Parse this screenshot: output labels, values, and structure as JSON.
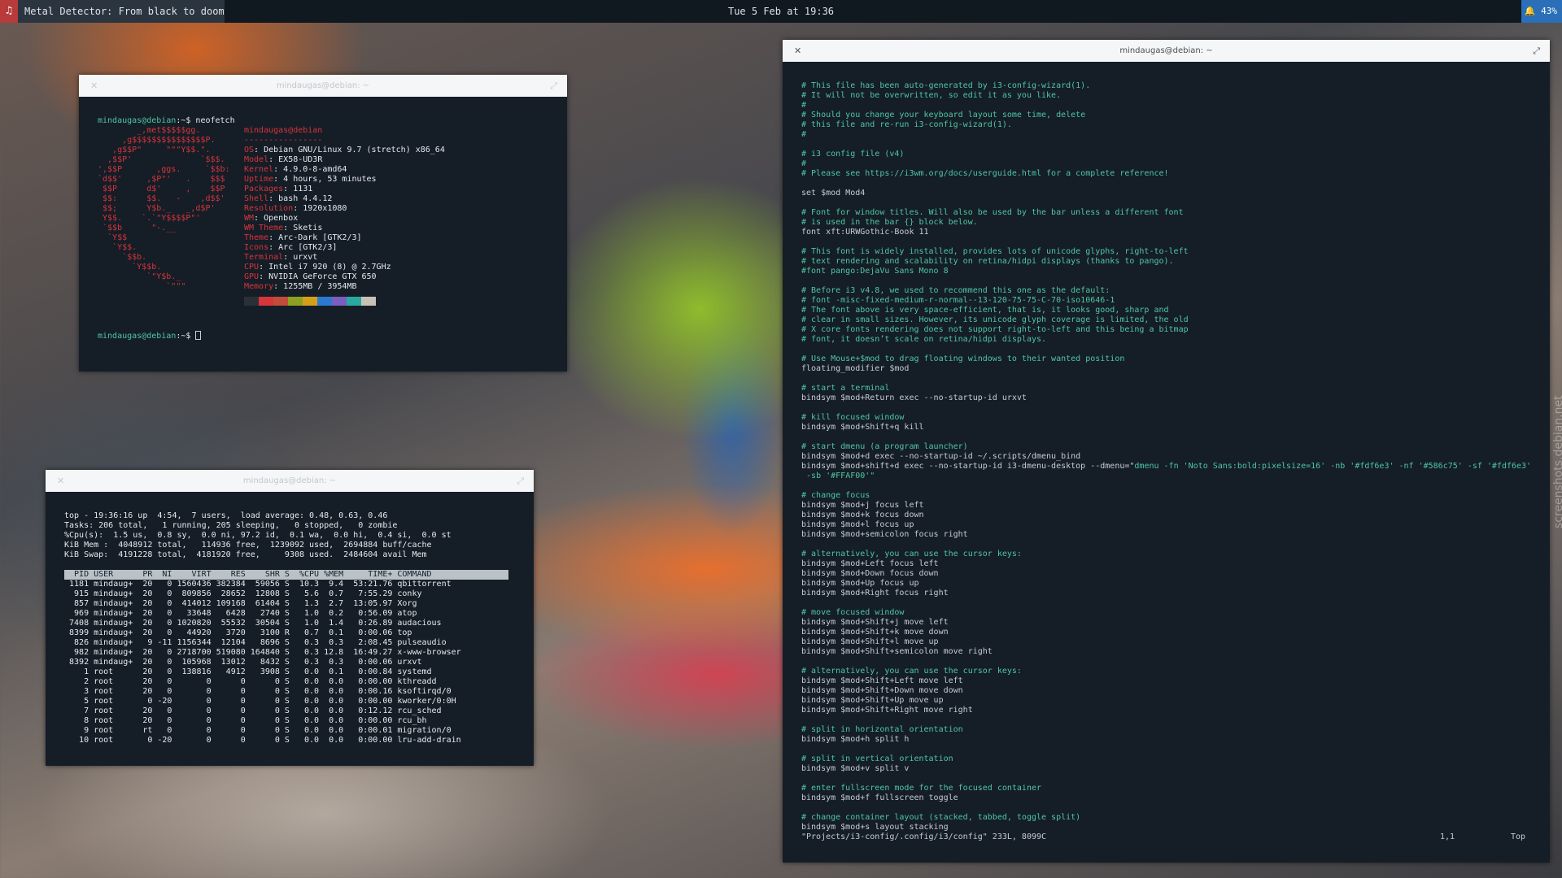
{
  "topbar": {
    "workspace": "♫",
    "window_title": "Metal Detector: From black to doom, prog",
    "clock": "Tue 5 Feb at 19:36",
    "battery": "🔔 43%"
  },
  "win_neofetch": {
    "title": "mindaugas@debian: ~",
    "close": "✕",
    "expand": "⤢",
    "prompt": "mindaugas@debian",
    "path_prompt": ":~$ ",
    "command": "neofetch",
    "user_host": "mindaugas@debian",
    "separator": "----------------",
    "logo": [
      "        _,met$$$$$gg.",
      "     ,g$$$$$$$$$$$$$$$P.",
      "   ,g$$P\"     \"\"\"Y$$.\".",
      "  ,$$P'              `$$$.",
      "',$$P       ,ggs.     `$$b:",
      "`d$$'     ,$P\"'   .    $$$",
      " $$P      d$'     ,    $$P",
      " $$:      $$.   -    ,d$$'",
      " $$;      Y$b._   _,d$P'",
      " Y$$.    `.`\"Y$$$$P\"'",
      " `$$b      \"-.__",
      "  `Y$$",
      "   `Y$$.",
      "     `$$b.",
      "       `Y$$b.",
      "          `\"Y$b._",
      "              `\"\"\""
    ],
    "info": [
      {
        "k": "OS",
        "v": "Debian GNU/Linux 9.7 (stretch) x86_64"
      },
      {
        "k": "Model",
        "v": "EX58-UD3R"
      },
      {
        "k": "Kernel",
        "v": "4.9.0-8-amd64"
      },
      {
        "k": "Uptime",
        "v": "4 hours, 53 minutes"
      },
      {
        "k": "Packages",
        "v": "1131"
      },
      {
        "k": "Shell",
        "v": "bash 4.4.12"
      },
      {
        "k": "Resolution",
        "v": "1920x1080"
      },
      {
        "k": "WM",
        "v": "Openbox"
      },
      {
        "k": "WM Theme",
        "v": "Sketis"
      },
      {
        "k": "Theme",
        "v": "Arc-Dark [GTK2/3]"
      },
      {
        "k": "Icons",
        "v": "Arc [GTK2/3]"
      },
      {
        "k": "Terminal",
        "v": "urxvt"
      },
      {
        "k": "CPU",
        "v": "Intel i7 920 (8) @ 2.7GHz"
      },
      {
        "k": "GPU",
        "v": "NVIDIA GeForce GTX 650"
      },
      {
        "k": "Memory",
        "v": "1255MB / 3954MB"
      }
    ],
    "colors": [
      "#2b2f36",
      "#d6353a",
      "#c14c3b",
      "#8ea021",
      "#d5a019",
      "#2a7bd0",
      "#7a5fc0",
      "#2aa9a0",
      "#c8c2b6"
    ]
  },
  "win_top": {
    "title": "mindaugas@debian: ~",
    "close": "✕",
    "expand": "⤢",
    "summary": [
      "top - 19:36:16 up  4:54,  7 users,  load average: 0.48, 0.63, 0.46",
      "Tasks: 206 total,   1 running, 205 sleeping,   0 stopped,   0 zombie",
      "%Cpu(s):  1.5 us,  0.8 sy,  0.0 ni, 97.2 id,  0.1 wa,  0.0 hi,  0.4 si,  0.0 st",
      "KiB Mem :  4048912 total,   114936 free,  1239092 used,  2694884 buff/cache",
      "KiB Swap:  4191228 total,  4181920 free,     9308 used.  2484604 avail Mem"
    ],
    "header": "  PID USER      PR  NI    VIRT    RES    SHR S  %CPU %MEM     TIME+ COMMAND",
    "rows": [
      " 1181 mindaug+  20   0 1560436 382384  59056 S  10.3  9.4  53:21.76 qbittorrent",
      "  915 mindaug+  20   0  809856  28652  12808 S   5.6  0.7   7:55.29 conky",
      "  857 mindaug+  20   0  414012 109168  61404 S   1.3  2.7  13:05.97 Xorg",
      "  969 mindaug+  20   0   33648   6428   2740 S   1.0  0.2   0:56.09 atop",
      " 7408 mindaug+  20   0 1020820  55532  30504 S   1.0  1.4   0:26.89 audacious",
      " 8399 mindaug+  20   0   44920   3720   3100 R   0.7  0.1   0:00.06 top",
      "  826 mindaug+   9 -11 1156344  12104   8696 S   0.3  0.3   2:08.45 pulseaudio",
      "  982 mindaug+  20   0 2718700 519080 164840 S   0.3 12.8  16:49.27 x-www-browser",
      " 8392 mindaug+  20   0  105968  13012   8432 S   0.3  0.3   0:00.06 urxvt",
      "    1 root      20   0  138816   4912   3908 S   0.0  0.1   0:00.84 systemd",
      "    2 root      20   0       0      0      0 S   0.0  0.0   0:00.00 kthreadd",
      "    3 root      20   0       0      0      0 S   0.0  0.0   0:00.16 ksoftirqd/0",
      "    5 root       0 -20       0      0      0 S   0.0  0.0   0:00.00 kworker/0:0H",
      "    7 root      20   0       0      0      0 S   0.0  0.0   0:12.12 rcu_sched",
      "    8 root      20   0       0      0      0 S   0.0  0.0   0:00.00 rcu_bh",
      "    9 root      rt   0       0      0      0 S   0.0  0.0   0:00.01 migration/0",
      "   10 root       0 -20       0      0      0 S   0.0  0.0   0:00.00 lru-add-drain"
    ]
  },
  "win_vim": {
    "title": "mindaugas@debian: ~",
    "close": "✕",
    "expand": "⤢",
    "lines": [
      {
        "t": "c",
        "s": "# This file has been auto-generated by i3-config-wizard(1)."
      },
      {
        "t": "c",
        "s": "# It will not be overwritten, so edit it as you like."
      },
      {
        "t": "c",
        "s": "#"
      },
      {
        "t": "c",
        "s": "# Should you change your keyboard layout some time, delete"
      },
      {
        "t": "c",
        "s": "# this file and re-run i3-config-wizard(1)."
      },
      {
        "t": "c",
        "s": "#"
      },
      {
        "t": "n",
        "s": ""
      },
      {
        "t": "c",
        "s": "# i3 config file (v4)"
      },
      {
        "t": "c",
        "s": "#"
      },
      {
        "t": "c",
        "s": "# Please see https://i3wm.org/docs/userguide.html for a complete reference!"
      },
      {
        "t": "n",
        "s": ""
      },
      {
        "t": "n",
        "s": "set $mod Mod4"
      },
      {
        "t": "n",
        "s": ""
      },
      {
        "t": "c",
        "s": "# Font for window titles. Will also be used by the bar unless a different font"
      },
      {
        "t": "c",
        "s": "# is used in the bar {} block below."
      },
      {
        "t": "n",
        "s": "font xft:URWGothic-Book 11"
      },
      {
        "t": "n",
        "s": ""
      },
      {
        "t": "c",
        "s": "# This font is widely installed, provides lots of unicode glyphs, right-to-left"
      },
      {
        "t": "c",
        "s": "# text rendering and scalability on retina/hidpi displays (thanks to pango)."
      },
      {
        "t": "c",
        "s": "#font pango:DejaVu Sans Mono 8"
      },
      {
        "t": "n",
        "s": ""
      },
      {
        "t": "c",
        "s": "# Before i3 v4.8, we used to recommend this one as the default:"
      },
      {
        "t": "c",
        "s": "# font -misc-fixed-medium-r-normal--13-120-75-75-C-70-iso10646-1"
      },
      {
        "t": "c",
        "s": "# The font above is very space-efficient, that is, it looks good, sharp and"
      },
      {
        "t": "c",
        "s": "# clear in small sizes. However, its unicode glyph coverage is limited, the old"
      },
      {
        "t": "c",
        "s": "# X core fonts rendering does not support right-to-left and this being a bitmap"
      },
      {
        "t": "c",
        "s": "# font, it doesn’t scale on retina/hidpi displays."
      },
      {
        "t": "n",
        "s": ""
      },
      {
        "t": "c",
        "s": "# Use Mouse+$mod to drag floating windows to their wanted position"
      },
      {
        "t": "n",
        "s": "floating_modifier $mod"
      },
      {
        "t": "n",
        "s": ""
      },
      {
        "t": "c",
        "s": "# start a terminal"
      },
      {
        "t": "n",
        "s": "bindsym $mod+Return exec --no-startup-id urxvt"
      },
      {
        "t": "n",
        "s": ""
      },
      {
        "t": "c",
        "s": "# kill focused window"
      },
      {
        "t": "n",
        "s": "bindsym $mod+Shift+q kill"
      },
      {
        "t": "n",
        "s": ""
      },
      {
        "t": "c",
        "s": "# start dmenu (a program launcher)"
      },
      {
        "t": "n",
        "s": "bindsym $mod+d exec --no-startup-id ~/.scripts/dmenu_bind"
      },
      {
        "t": "d",
        "a": "bindsym $mod+shift+d exec --no-startup-id i3-dmenu-desktop --dmenu=\"",
        "b": "dmenu -fn 'Noto Sans:bold:pixelsize=16' -nb '#fdf6e3' -nf '#586c75' -sf '#fdf6e3'"
      },
      {
        "t": "d",
        "a": " ",
        "b": "-sb '#FFAF00'\""
      },
      {
        "t": "n",
        "s": ""
      },
      {
        "t": "c",
        "s": "# change focus"
      },
      {
        "t": "n",
        "s": "bindsym $mod+j focus left"
      },
      {
        "t": "n",
        "s": "bindsym $mod+k focus down"
      },
      {
        "t": "n",
        "s": "bindsym $mod+l focus up"
      },
      {
        "t": "n",
        "s": "bindsym $mod+semicolon focus right"
      },
      {
        "t": "n",
        "s": ""
      },
      {
        "t": "c",
        "s": "# alternatively, you can use the cursor keys:"
      },
      {
        "t": "n",
        "s": "bindsym $mod+Left focus left"
      },
      {
        "t": "n",
        "s": "bindsym $mod+Down focus down"
      },
      {
        "t": "n",
        "s": "bindsym $mod+Up focus up"
      },
      {
        "t": "n",
        "s": "bindsym $mod+Right focus right"
      },
      {
        "t": "n",
        "s": ""
      },
      {
        "t": "c",
        "s": "# move focused window"
      },
      {
        "t": "n",
        "s": "bindsym $mod+Shift+j move left"
      },
      {
        "t": "n",
        "s": "bindsym $mod+Shift+k move down"
      },
      {
        "t": "n",
        "s": "bindsym $mod+Shift+l move up"
      },
      {
        "t": "n",
        "s": "bindsym $mod+Shift+semicolon move right"
      },
      {
        "t": "n",
        "s": ""
      },
      {
        "t": "c",
        "s": "# alternatively, you can use the cursor keys:"
      },
      {
        "t": "n",
        "s": "bindsym $mod+Shift+Left move left"
      },
      {
        "t": "n",
        "s": "bindsym $mod+Shift+Down move down"
      },
      {
        "t": "n",
        "s": "bindsym $mod+Shift+Up move up"
      },
      {
        "t": "n",
        "s": "bindsym $mod+Shift+Right move right"
      },
      {
        "t": "n",
        "s": ""
      },
      {
        "t": "c",
        "s": "# split in horizontal orientation"
      },
      {
        "t": "n",
        "s": "bindsym $mod+h split h"
      },
      {
        "t": "n",
        "s": ""
      },
      {
        "t": "c",
        "s": "# split in vertical orientation"
      },
      {
        "t": "n",
        "s": "bindsym $mod+v split v"
      },
      {
        "t": "n",
        "s": ""
      },
      {
        "t": "c",
        "s": "# enter fullscreen mode for the focused container"
      },
      {
        "t": "n",
        "s": "bindsym $mod+f fullscreen toggle"
      },
      {
        "t": "n",
        "s": ""
      },
      {
        "t": "c",
        "s": "# change container layout (stacked, tabbed, toggle split)"
      },
      {
        "t": "n",
        "s": "bindsym $mod+s layout stacking"
      }
    ],
    "status_file": "\"Projects/i3-config/.config/i3/config\" 233L, 8099C",
    "status_pos": "1,1",
    "status_scroll": "Top"
  },
  "watermark": "screenshots.debian.net",
  "colors": {
    "comment": "#4fc6a4",
    "text": "#c7ccd3",
    "red": "#d6353a",
    "bar_bg": "#101820",
    "accent": "#2a6fb8"
  }
}
